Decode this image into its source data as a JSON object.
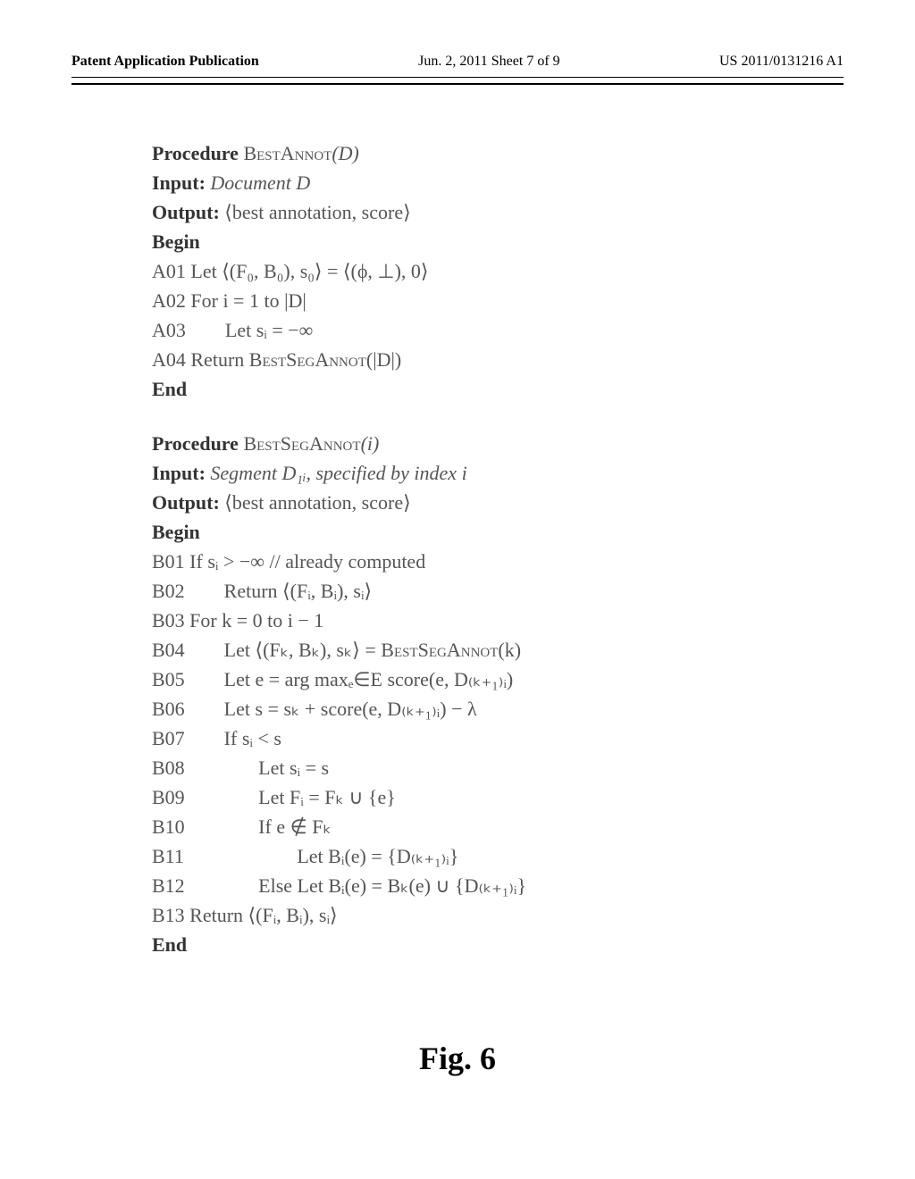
{
  "header": {
    "left": "Patent Application Publication",
    "mid": "Jun. 2, 2011  Sheet 7 of 9",
    "right": "US 2011/0131216 A1"
  },
  "proc1": {
    "l1a": "Procedure ",
    "l1b": "BestAnnot",
    "l1c": "(D)",
    "l2a": "Input: ",
    "l2b": "Document D",
    "l3a": "Output: ",
    "l3b": "⟨best annotation, score⟩",
    "l4": "Begin",
    "l5": "A01 Let ⟨(F₀, B₀), s₀⟩ = ⟨(ϕ, ⊥), 0⟩",
    "l6": "A02 For i = 1 to |D|",
    "l7": "A03        Let sᵢ = −∞",
    "l8a": "A04 Return ",
    "l8b": "BestSegAnnot",
    "l8c": "(|D|)",
    "l9": "End"
  },
  "proc2": {
    "l1a": "Procedure ",
    "l1b": "BestSegAnnot",
    "l1c": "(i)",
    "l2a": "Input: ",
    "l2b": "Segment D₁ᵢ, specified by index i",
    "l3a": "Output: ",
    "l3b": "⟨best annotation, score⟩",
    "l4": "Begin",
    "l5": "B01 If sᵢ > −∞ // already computed",
    "l6": "B02        Return ⟨(Fᵢ, Bᵢ), sᵢ⟩",
    "l7": "B03 For k = 0 to i − 1",
    "l8a": "B04        Let ⟨(Fₖ, Bₖ), sₖ⟩ = ",
    "l8b": "BestSegAnnot",
    "l8c": "(k)",
    "l9": "B05        Let e = arg maxₑ∈E score(e, D₍ₖ₊₁₎ᵢ)",
    "l10": "B06        Let s = sₖ + score(e, D₍ₖ₊₁₎ᵢ) − λ",
    "l11": "B07        If sᵢ < s",
    "l12": "B08               Let sᵢ = s",
    "l13": "B09               Let Fᵢ = Fₖ ∪ {e}",
    "l14": "B10               If e ∉ Fₖ",
    "l15": "B11                       Let Bᵢ(e) = {D₍ₖ₊₁₎ᵢ}",
    "l16": "B12               Else Let Bᵢ(e) = Bₖ(e) ∪ {D₍ₖ₊₁₎ᵢ}",
    "l17": "B13 Return ⟨(Fᵢ, Bᵢ), sᵢ⟩",
    "l18": "End"
  },
  "figure_caption": "Fig. 6"
}
